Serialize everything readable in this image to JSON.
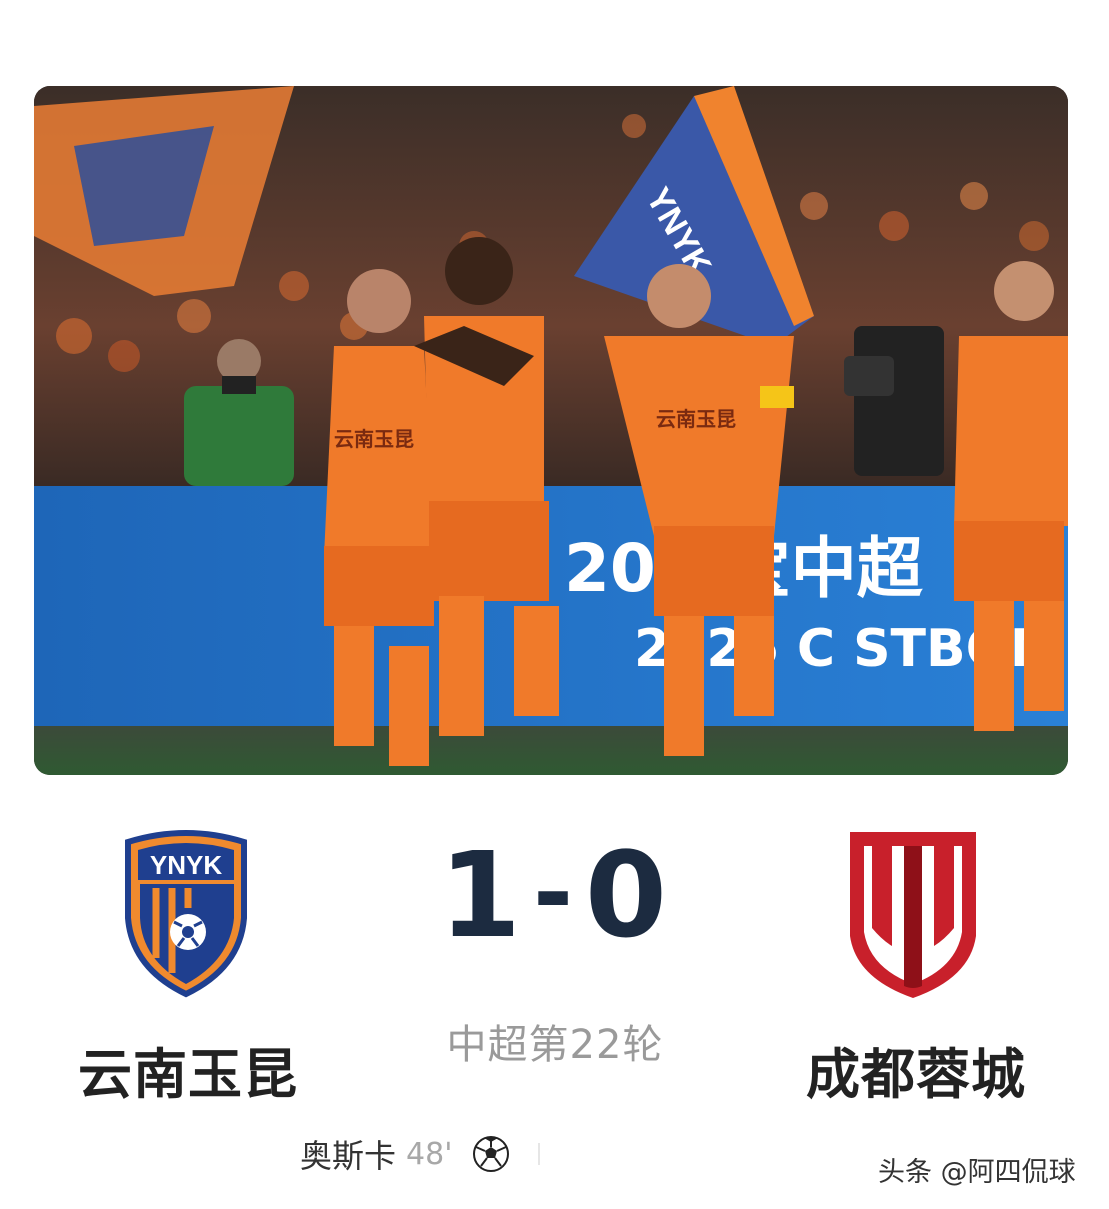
{
  "match": {
    "home_team": "云南玉昆",
    "away_team": "成都蓉城",
    "home_score": "1",
    "separator": "-",
    "away_score": "0",
    "round": "中超第22轮"
  },
  "goals": [
    {
      "scorer": "奥斯卡",
      "minute": "48'"
    }
  ],
  "home_logo": {
    "text": "YNYK"
  },
  "banner": {
    "text_top": "202 宝中超",
    "text_bottom": "2026 C STBON C"
  },
  "player_shirt_text": "云南玉昆",
  "watermark": "头条 @阿四侃球",
  "colors": {
    "score": "#1c2b40",
    "team_name": "#222222",
    "round": "#9a9a9a",
    "home_orange": "#f07a2a",
    "home_blue": "#1f3f8f",
    "away_red": "#c8202b"
  }
}
